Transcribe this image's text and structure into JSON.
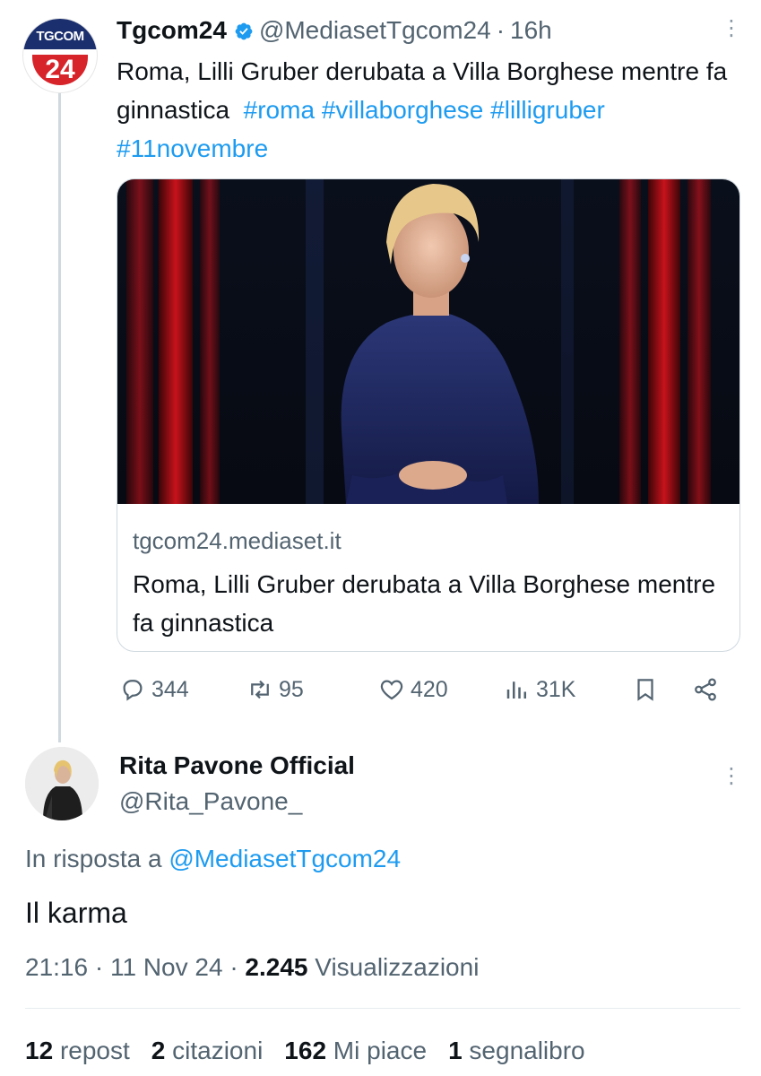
{
  "tweet": {
    "author_name": "Tgcom24",
    "handle": "@MediasetTgcom24",
    "separator": "·",
    "time": "16h",
    "text": "Roma, Lilli Gruber derubata a Villa Borghese mentre fa ginnastica",
    "hashtags": [
      "#roma",
      "#villaborghese",
      "#lilligruber",
      "#11novembre"
    ],
    "avatar": {
      "top_text": "TGCOM",
      "bottom_text": "24"
    },
    "card": {
      "domain": "tgcom24.mediaset.it",
      "title": "Roma, Lilli Gruber derubata a Villa Borghese mentre fa ginnastica"
    },
    "actions": {
      "replies": "344",
      "reposts": "95",
      "likes": "420",
      "views": "31K"
    }
  },
  "reply": {
    "author_name": "Rita Pavone Official",
    "handle": "@Rita_Pavone_",
    "in_reply_prefix": "In risposta a",
    "in_reply_handle": "@MediasetTgcom24",
    "text": "Il karma",
    "time": "21:16",
    "date": "11 Nov 24",
    "views_count": "2.245",
    "views_label": "Visualizzazioni",
    "stats": [
      {
        "count": "12",
        "label": "repost"
      },
      {
        "count": "2",
        "label": "citazioni"
      },
      {
        "count": "162",
        "label": "Mi piace"
      },
      {
        "count": "1",
        "label": "segnalibro"
      }
    ]
  },
  "icons": [
    "more-icon",
    "verified-icon",
    "reply-icon",
    "repost-icon",
    "like-icon",
    "views-icon",
    "bookmark-icon",
    "share-icon"
  ],
  "colors": {
    "link_blue": "#1d9bf0",
    "muted_gray": "#536471",
    "text": "#0f1419"
  }
}
